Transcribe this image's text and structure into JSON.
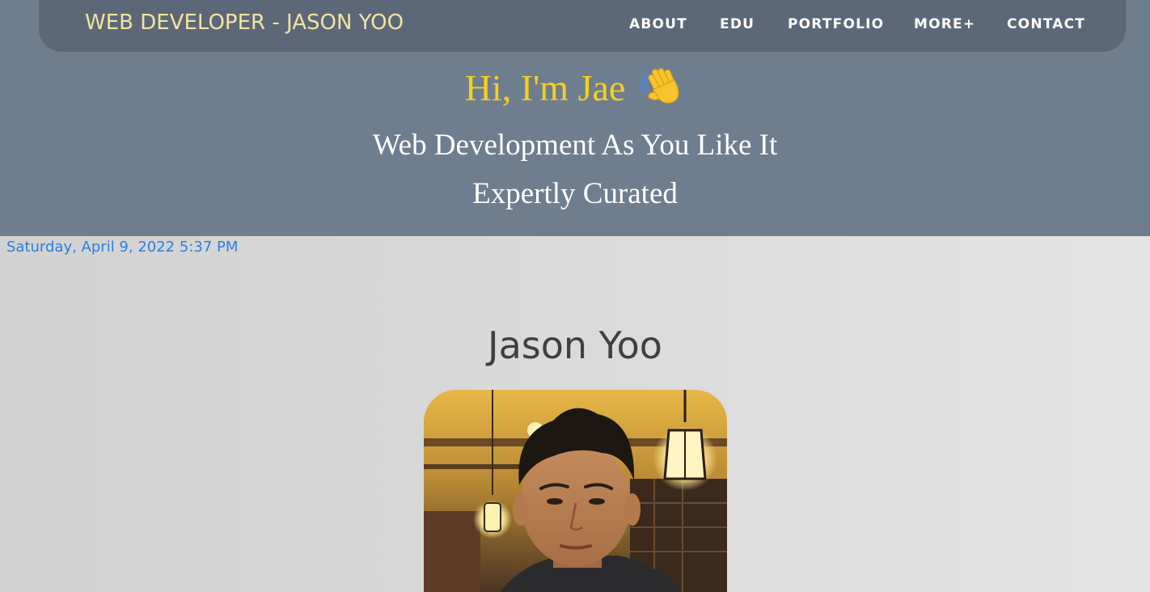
{
  "navbar": {
    "brand": "WEB DEVELOPER - JASON YOO",
    "links": [
      "ABOUT",
      "EDU",
      "PORTFOLIO",
      "MORE+",
      "CONTACT"
    ]
  },
  "hero": {
    "greeting": "Hi, I'm Jae",
    "greeting_icon": "waving-hand-icon",
    "tagline_line1": "Web Development As You Like It",
    "tagline_line2": "Expertly Curated"
  },
  "datetime": "Saturday, April 9, 2022 5:37 PM",
  "profile": {
    "name": "Jason Yoo",
    "photo_icon": "profile-photo"
  },
  "colors": {
    "hero_bg": "#6f7e8f",
    "navbar_bg": "#5c6878",
    "brand_text": "#f1e3a1",
    "greeting": "#f5cf1f",
    "datetime": "#2a7ee0",
    "name_text": "#3f3f3f"
  }
}
